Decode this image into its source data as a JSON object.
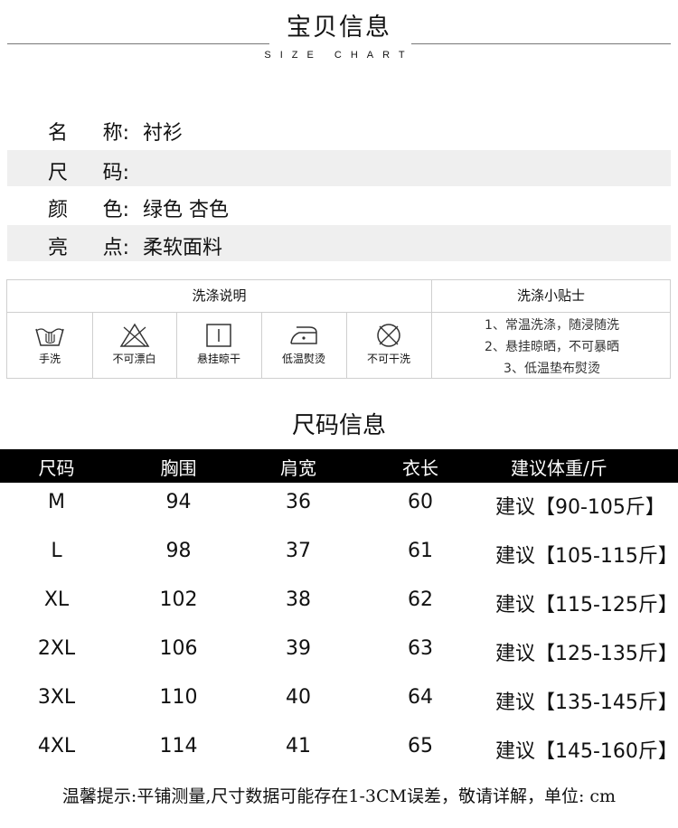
{
  "header": {
    "title": "宝贝信息",
    "subtitle": "SIZE CHART"
  },
  "info": [
    {
      "label_a": "名",
      "label_b": "称:",
      "value": "衬衫"
    },
    {
      "label_a": "尺",
      "label_b": "码:",
      "value": ""
    },
    {
      "label_a": "颜",
      "label_b": "色:",
      "value": "绿色 杏色"
    },
    {
      "label_a": "亮",
      "label_b": "点:",
      "value": "柔软面料"
    }
  ],
  "care": {
    "instructions_title": "洗涤说明",
    "tips_title": "洗涤小贴士",
    "items": [
      {
        "icon": "hand-wash-icon",
        "label": "手洗"
      },
      {
        "icon": "no-bleach-icon",
        "label": "不可漂白"
      },
      {
        "icon": "hang-dry-icon",
        "label": "悬挂晾干"
      },
      {
        "icon": "low-iron-icon",
        "label": "低温熨烫"
      },
      {
        "icon": "no-dry-clean-icon",
        "label": "不可干洗"
      }
    ],
    "tips": [
      "1、常温洗涤，随浸随洗",
      "2、悬挂晾晒，不可暴晒",
      "3、低温垫布熨烫"
    ]
  },
  "size": {
    "title": "尺码信息",
    "columns": [
      "尺码",
      "胸围",
      "肩宽",
      "衣长",
      "建议体重/斤"
    ],
    "rows": [
      [
        "M",
        "94",
        "36",
        "60",
        "建议【90-105斤】"
      ],
      [
        "L",
        "98",
        "37",
        "61",
        "建议【105-115斤】"
      ],
      [
        "XL",
        "102",
        "38",
        "62",
        "建议【115-125斤】"
      ],
      [
        "2XL",
        "106",
        "39",
        "63",
        "建议【125-135斤】"
      ],
      [
        "3XL",
        "110",
        "40",
        "64",
        "建议【135-145斤】"
      ],
      [
        "4XL",
        "114",
        "41",
        "65",
        "建议【145-160斤】"
      ]
    ]
  },
  "note": "温馨提示:平铺测量,尺寸数据可能存在1-3CM误差，敬请详解，单位: cm"
}
